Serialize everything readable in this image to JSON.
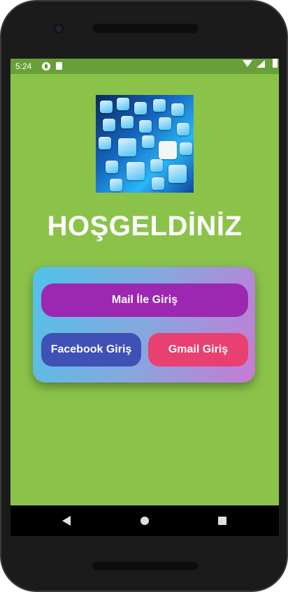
{
  "status_bar": {
    "time": "5:24",
    "icons": [
      "app-notification-icon",
      "sd-card-icon",
      "wifi-icon",
      "signal-icon",
      "battery-icon"
    ]
  },
  "hero_image": {
    "icon": "social-media-apps-image"
  },
  "welcome_title": "HOŞGELDİNİZ",
  "buttons": {
    "mail_label": "Mail İle Giriş",
    "facebook_label": "Facebook Giriş",
    "gmail_label": "Gmail Giriş"
  },
  "nav_bar": {
    "icons": [
      "back-icon",
      "home-icon",
      "recents-icon"
    ]
  },
  "colors": {
    "background": "#8bc34a",
    "status_bar": "#689f38",
    "mail_button": "#9c27b0",
    "facebook_button": "#3f51b5",
    "gmail_button": "#e84070",
    "card_gradient_start": "#4fc3e8",
    "card_gradient_end": "#c77ad4"
  }
}
